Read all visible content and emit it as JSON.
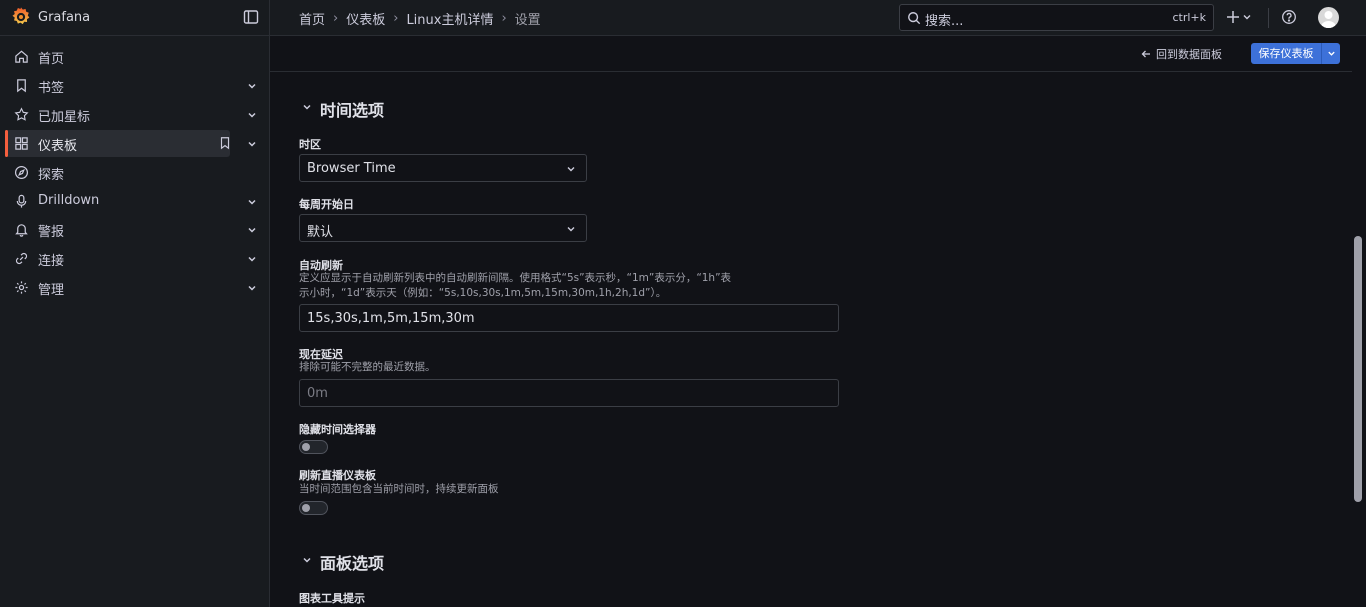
{
  "app": {
    "brand": "Grafana"
  },
  "breadcrumb": [
    "首页",
    "仪表板",
    "Linux主机详情",
    "设置"
  ],
  "search": {
    "placeholder": "搜索...",
    "shortcut": "ctrl+k"
  },
  "sidebar": {
    "items": [
      {
        "label": "首页",
        "icon": "home-icon"
      },
      {
        "label": "书签",
        "icon": "bookmark-icon"
      },
      {
        "label": "已加星标",
        "icon": "star-icon"
      },
      {
        "label": "仪表板",
        "icon": "apps-icon"
      },
      {
        "label": "探索",
        "icon": "compass-icon"
      },
      {
        "label": "Drilldown",
        "icon": "microphone-icon"
      },
      {
        "label": "警报",
        "icon": "bell-icon"
      },
      {
        "label": "连接",
        "icon": "link-icon"
      },
      {
        "label": "管理",
        "icon": "cog-icon"
      }
    ]
  },
  "actions": {
    "back_label": "回到数据面板",
    "save_label": "保存仪表板"
  },
  "sections": {
    "time": {
      "title": "时间选项",
      "timezone_label": "时区",
      "timezone_value": "Browser Time",
      "week_start_label": "每周开始日",
      "week_start_value": "默认",
      "refresh_label": "自动刷新",
      "refresh_desc": "定义应显示于自动刷新列表中的自动刷新间隔。使用格式“5s”表示秒，“1m”表示分，“1h”表示小时，“1d”表示天（例如：“5s,10s,30s,1m,5m,15m,30m,1h,2h,1d”）。",
      "refresh_value": "15s,30s,1m,5m,15m,30m",
      "now_delay_label": "现在延迟",
      "now_delay_desc": "排除可能不完整的最近数据。",
      "now_delay_placeholder": "0m",
      "hide_picker_label": "隐藏时间选择器",
      "live_label": "刷新直播仪表板",
      "live_desc": "当时间范围包含当前时间时，持续更新面板"
    },
    "panel": {
      "title": "面板选项",
      "tooltip_label": "图表工具提示"
    }
  },
  "colors": {
    "accent": "#f55f3e",
    "primary": "#3d71d9"
  }
}
